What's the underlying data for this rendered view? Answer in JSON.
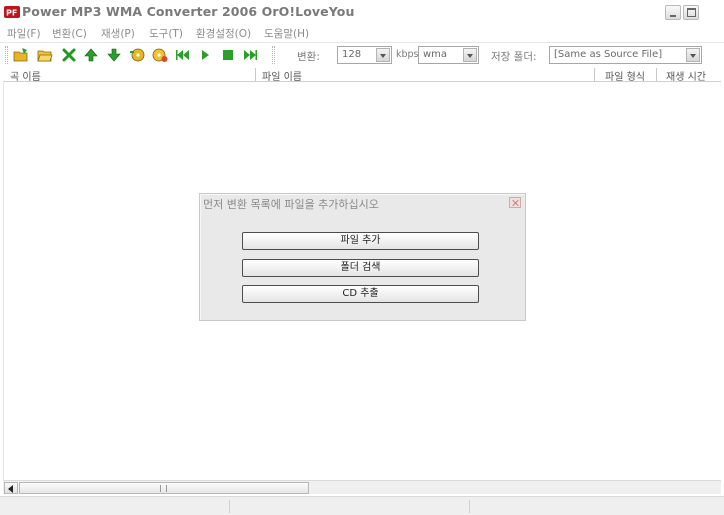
{
  "window": {
    "title": "Power MP3 WMA Converter 2006    OrO!LoveYou"
  },
  "menu": [
    "파일(F)",
    "변환(C)",
    "재생(P)",
    "도구(T)",
    "환경설정(O)",
    "도움말(H)"
  ],
  "toolbar": {
    "icons": [
      "add-file",
      "add-folder",
      "remove",
      "move-up",
      "move-down",
      "cd-extract",
      "cd-rip",
      "previous",
      "play",
      "stop",
      "next"
    ],
    "bitrate_label": "변환:",
    "bitrate_value": "128",
    "kbps_label": "kbps",
    "format_value": "wma",
    "output_label": "저장 폴더:",
    "output_value": "[Same as Source File]"
  },
  "list": {
    "columns": [
      "곡 이름",
      "파일 이름",
      "파일 형식",
      "재생 시간"
    ]
  },
  "dialog": {
    "title": "먼저 변환 목록에 파일을 추가하십시오",
    "buttons": [
      "파일 추가",
      "폴더 검색",
      "CD 추출"
    ]
  }
}
